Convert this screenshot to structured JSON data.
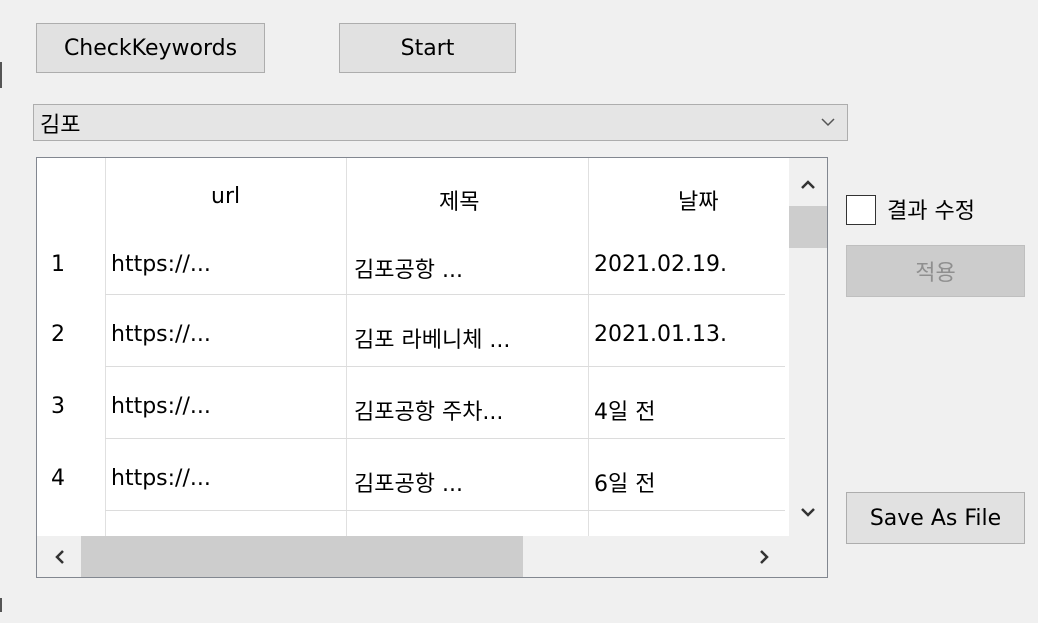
{
  "toolbar": {
    "check_keywords_label": "CheckKeywords",
    "start_label": "Start"
  },
  "keyword_combo": {
    "selected": "김포"
  },
  "results_grid": {
    "columns": [
      "",
      "url",
      "제목",
      "날짜"
    ],
    "rows": [
      {
        "index": "1",
        "url": "https://...",
        "title": "김포공항 ...",
        "date": "2021.02.19."
      },
      {
        "index": "2",
        "url": "https://...",
        "title": "김포 라베니체 ...",
        "date": "2021.01.13."
      },
      {
        "index": "3",
        "url": "https://...",
        "title": "김포공항 주차...",
        "date": "4일 전"
      },
      {
        "index": "4",
        "url": "https://...",
        "title": "김포공항 ...",
        "date": "6일 전"
      }
    ]
  },
  "side_panel": {
    "edit_results_label": "결과 수정",
    "edit_results_checked": false,
    "apply_label": "적용",
    "save_label": "Save As File"
  },
  "colors": {
    "button_bg": "#e1e1e1",
    "button_border": "#adadad",
    "disabled_text": "#8f8f8f",
    "window_bg": "#f0f0f0",
    "grid_line": "#dcdcdc",
    "scroll_thumb": "#cdcdcd"
  }
}
